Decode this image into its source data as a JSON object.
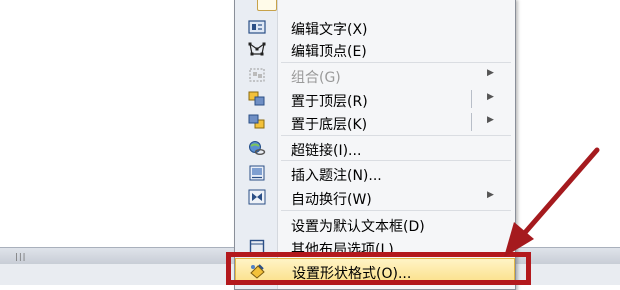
{
  "menu": {
    "items": [
      {
        "label": "编辑文字(X)",
        "icon": "text-box-icon"
      },
      {
        "label": "编辑顶点(E)",
        "icon": "edit-points-icon"
      },
      {
        "label": "组合(G)",
        "icon": "group-icon",
        "disabled": true,
        "submenu": true
      },
      {
        "label": "置于顶层(R)",
        "icon": "bring-to-front-icon",
        "submenu": true
      },
      {
        "label": "置于底层(K)",
        "icon": "send-to-back-icon",
        "submenu": true
      },
      {
        "label": "超链接(I)...",
        "icon": "hyperlink-icon"
      },
      {
        "label": "插入题注(N)...",
        "icon": "insert-caption-icon"
      },
      {
        "label": "自动换行(W)",
        "icon": "text-wrap-icon",
        "submenu": true
      },
      {
        "label": "设置为默认文本框(D)",
        "icon": ""
      },
      {
        "label": "其他布局选项(L)...",
        "icon": "layout-options-icon"
      },
      {
        "label": "设置形状格式(O)...",
        "icon": "format-shape-icon",
        "highlighted": true
      }
    ]
  },
  "colors": {
    "highlight_border": "#b3191d",
    "arrow": "#a51a1e",
    "menu_hover": "#fbe089"
  }
}
